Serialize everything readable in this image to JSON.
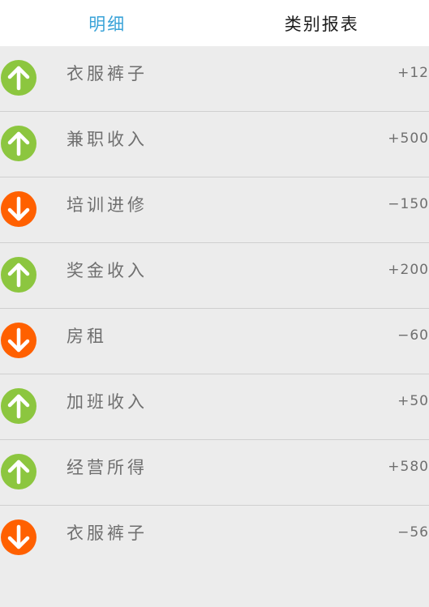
{
  "tabs": {
    "detail_label": "明细",
    "report_label": "类别报表",
    "active": "detail"
  },
  "colors": {
    "income": "#8cc63f",
    "expense": "#ff6000",
    "accent": "#3aa3d8"
  },
  "rows": [
    {
      "title": "衣服裤子",
      "amount": "+12",
      "type": "income",
      "icon": "arrow-up-icon"
    },
    {
      "title": "兼职收入",
      "amount": "+500",
      "type": "income",
      "icon": "arrow-up-icon"
    },
    {
      "title": "培训进修",
      "amount": "−150",
      "type": "expense",
      "icon": "arrow-down-icon"
    },
    {
      "title": "奖金收入",
      "amount": "+200",
      "type": "income",
      "icon": "arrow-up-icon"
    },
    {
      "title": "房租",
      "amount": "−60",
      "type": "expense",
      "icon": "arrow-down-icon"
    },
    {
      "title": "加班收入",
      "amount": "+50",
      "type": "income",
      "icon": "arrow-up-icon"
    },
    {
      "title": "经营所得",
      "amount": "+580",
      "type": "income",
      "icon": "arrow-up-icon"
    },
    {
      "title": "衣服裤子",
      "amount": "−56",
      "type": "expense",
      "icon": "arrow-down-icon"
    }
  ]
}
